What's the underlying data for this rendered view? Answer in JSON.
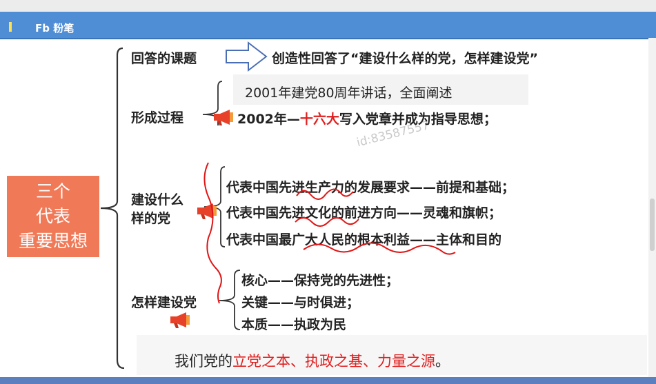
{
  "header": {
    "logo": "Fb 粉笔"
  },
  "watermark": "id:83587557",
  "main_topic": "三个\n代表\n重要思想",
  "answer": {
    "label": "回答的课题",
    "text": "创造性回答了“建设什么样的党，怎样建设党”"
  },
  "formation": {
    "label": "形成过程",
    "line1": "2001年建党80周年讲话，全面阐述",
    "line2_prefix": "2002年—",
    "line2_highlight": "十六大",
    "line2_suffix": "写入党章并成为指导思想；"
  },
  "build_what": {
    "label": "建设什么\n样的党",
    "items": [
      "代表中国先进生产力的发展要求——前提和基础；",
      "代表中国先进文化的前进方向——灵魂和旗帜；",
      "代表中国最广大人民的根本利益——主体和目的"
    ]
  },
  "build_how": {
    "label": "怎样建设党",
    "items": [
      "核心——保持党的先进性；",
      "关键——与时俱进；",
      "本质——执政为民"
    ]
  },
  "summary": {
    "prefix": "我们党的",
    "highlight": "立党之本、执政之基、力量之源",
    "suffix": "。"
  },
  "colors": {
    "header": "#4f8ed4",
    "main_box": "#f07a58",
    "highlight": "#e02020",
    "ink": "#e01515",
    "megaphone": "#e8412a"
  },
  "icons": [
    "right-arrow-icon",
    "megaphone-icon"
  ]
}
